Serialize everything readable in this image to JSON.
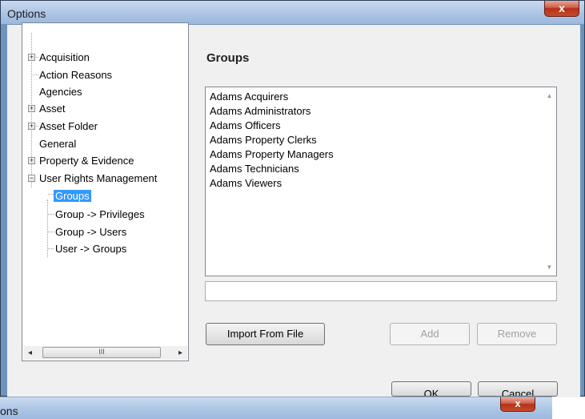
{
  "window": {
    "title": "Options",
    "close_glyph": "x"
  },
  "tree": {
    "items": [
      {
        "label": "Acquisition",
        "expander": "+"
      },
      {
        "label": "Action Reasons"
      },
      {
        "label": "Agencies"
      },
      {
        "label": "Asset",
        "expander": "+"
      },
      {
        "label": "Asset Folder",
        "expander": "+"
      },
      {
        "label": "General"
      },
      {
        "label": "Property & Evidence",
        "expander": "+"
      },
      {
        "label": "User Rights Management",
        "expander": "−"
      }
    ],
    "children": [
      {
        "label": "Groups",
        "selected": true
      },
      {
        "label": "Group -> Privileges"
      },
      {
        "label": "Group -> Users"
      },
      {
        "label": "User -> Groups"
      }
    ],
    "scroll_grip": "III"
  },
  "panel": {
    "heading": "Groups",
    "groups": [
      "Adams Acquirers",
      "Adams Administrators",
      "Adams Officers",
      "Adams Property Clerks",
      "Adams Property Managers",
      "Adams Technicians",
      "Adams Viewers"
    ],
    "new_group_value": "",
    "import_label": "Import From File",
    "add_label": "Add",
    "remove_label": "Remove",
    "ok_label": "OK",
    "cancel_label": "Cancel"
  },
  "background_window": {
    "title": "ons",
    "close_glyph": "x"
  }
}
